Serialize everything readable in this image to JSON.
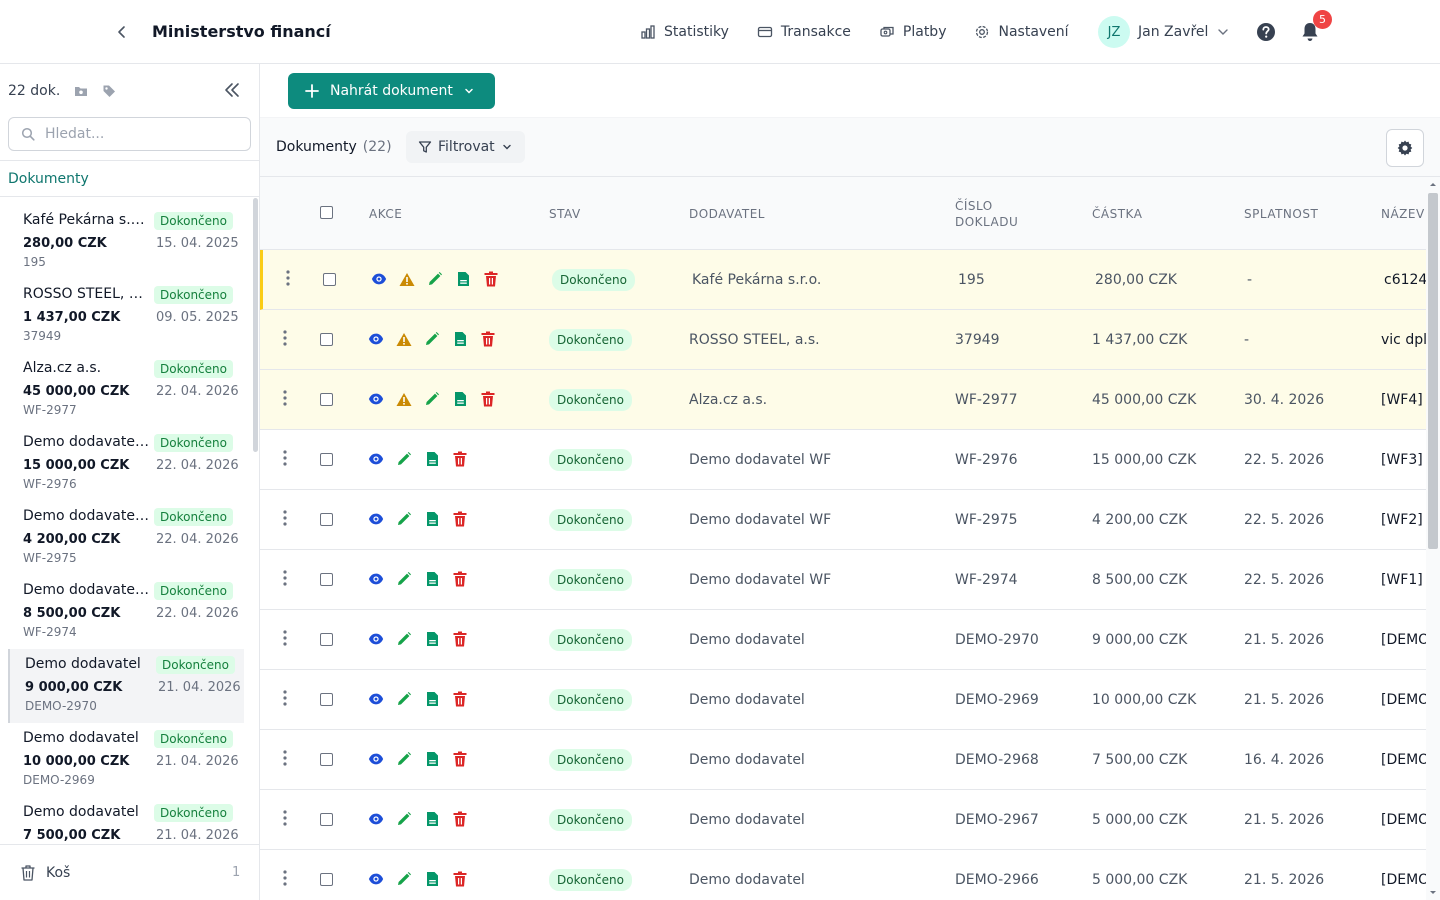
{
  "header": {
    "title": "Ministerstvo financí",
    "nav": [
      {
        "label": "Statistiky",
        "icon": "chart-icon"
      },
      {
        "label": "Transakce",
        "icon": "card-icon"
      },
      {
        "label": "Platby",
        "icon": "payments-icon"
      },
      {
        "label": "Nastavení",
        "icon": "gear-icon"
      }
    ],
    "user": {
      "initials": "JZ",
      "name": "Jan Zavřel"
    },
    "notifications": "5"
  },
  "sidebar": {
    "count": "22 dok.",
    "search_placeholder": "Hledat...",
    "section": "Dokumenty",
    "items": [
      {
        "name": "Kafé Pekárna s.r.o.",
        "status": "Dokončeno",
        "amount": "280,00 CZK",
        "date": "15. 04. 2025",
        "number": "195"
      },
      {
        "name": "ROSSO STEEL, a.s.",
        "status": "Dokončeno",
        "amount": "1 437,00 CZK",
        "date": "09. 05. 2025",
        "number": "37949"
      },
      {
        "name": "Alza.cz a.s.",
        "status": "Dokončeno",
        "amount": "45 000,00 CZK",
        "date": "22. 04. 2026",
        "number": "WF-2977"
      },
      {
        "name": "Demo dodavatel WF",
        "status": "Dokončeno",
        "amount": "15 000,00 CZK",
        "date": "22. 04. 2026",
        "number": "WF-2976"
      },
      {
        "name": "Demo dodavatel WF",
        "status": "Dokončeno",
        "amount": "4 200,00 CZK",
        "date": "22. 04. 2026",
        "number": "WF-2975"
      },
      {
        "name": "Demo dodavatel WF",
        "status": "Dokončeno",
        "amount": "8 500,00 CZK",
        "date": "22. 04. 2026",
        "number": "WF-2974"
      },
      {
        "name": "Demo dodavatel",
        "status": "Dokončeno",
        "amount": "9 000,00 CZK",
        "date": "21. 04. 2026",
        "number": "DEMO-2970"
      },
      {
        "name": "Demo dodavatel",
        "status": "Dokončeno",
        "amount": "10 000,00 CZK",
        "date": "21. 04. 2026",
        "number": "DEMO-2969"
      },
      {
        "name": "Demo dodavatel",
        "status": "Dokončeno",
        "amount": "7 500,00 CZK",
        "date": "21. 04. 2026",
        "number": ""
      }
    ],
    "trash": {
      "label": "Koš",
      "count": "1"
    }
  },
  "main": {
    "upload_label": "Nahrát dokument",
    "toolbar": {
      "title": "Dokumenty",
      "count": "(22)",
      "filter_label": "Filtrovat"
    },
    "columns": [
      "Akce",
      "Stav",
      "Dodavatel",
      "Číslo dokladu",
      "Částka",
      "Splatnost",
      "Název"
    ],
    "rows": [
      {
        "warn": true,
        "status": "Dokončeno",
        "supplier": "Kafé Pekárna s.r.o.",
        "number": "195",
        "amount": "280,00 CZK",
        "due": "-",
        "name": "c6124"
      },
      {
        "warn": true,
        "status": "Dokončeno",
        "supplier": "ROSSO STEEL, a.s.",
        "number": "37949",
        "amount": "1 437,00 CZK",
        "due": "-",
        "name": "vic dpl"
      },
      {
        "warn": true,
        "status": "Dokončeno",
        "supplier": "Alza.cz a.s.",
        "number": "WF-2977",
        "amount": "45 000,00 CZK",
        "due": "30. 4. 2026",
        "name": "[WF4]"
      },
      {
        "warn": false,
        "status": "Dokončeno",
        "supplier": "Demo dodavatel WF",
        "number": "WF-2976",
        "amount": "15 000,00 CZK",
        "due": "22. 5. 2026",
        "name": "[WF3]"
      },
      {
        "warn": false,
        "status": "Dokončeno",
        "supplier": "Demo dodavatel WF",
        "number": "WF-2975",
        "amount": "4 200,00 CZK",
        "due": "22. 5. 2026",
        "name": "[WF2]"
      },
      {
        "warn": false,
        "status": "Dokončeno",
        "supplier": "Demo dodavatel WF",
        "number": "WF-2974",
        "amount": "8 500,00 CZK",
        "due": "22. 5. 2026",
        "name": "[WF1]"
      },
      {
        "warn": false,
        "status": "Dokončeno",
        "supplier": "Demo dodavatel",
        "number": "DEMO-2970",
        "amount": "9 000,00 CZK",
        "due": "21. 5. 2026",
        "name": "[DEMO"
      },
      {
        "warn": false,
        "status": "Dokončeno",
        "supplier": "Demo dodavatel",
        "number": "DEMO-2969",
        "amount": "10 000,00 CZK",
        "due": "21. 5. 2026",
        "name": "[DEMO"
      },
      {
        "warn": false,
        "status": "Dokončeno",
        "supplier": "Demo dodavatel",
        "number": "DEMO-2968",
        "amount": "7 500,00 CZK",
        "due": "16. 4. 2026",
        "name": "[DEMO"
      },
      {
        "warn": false,
        "status": "Dokončeno",
        "supplier": "Demo dodavatel",
        "number": "DEMO-2967",
        "amount": "5 000,00 CZK",
        "due": "21. 5. 2026",
        "name": "[DEMO"
      },
      {
        "warn": false,
        "status": "Dokončeno",
        "supplier": "Demo dodavatel",
        "number": "DEMO-2966",
        "amount": "5 000,00 CZK",
        "due": "21. 5. 2026",
        "name": "[DEMO"
      }
    ]
  },
  "colors": {
    "accent": "#0d8b7e",
    "status_bg": "#dcfce7",
    "status_text": "#166534",
    "warn_row": "#fefce8",
    "danger": "#dc2626",
    "view": "#1d4ed8",
    "warning": "#ca8a04"
  }
}
